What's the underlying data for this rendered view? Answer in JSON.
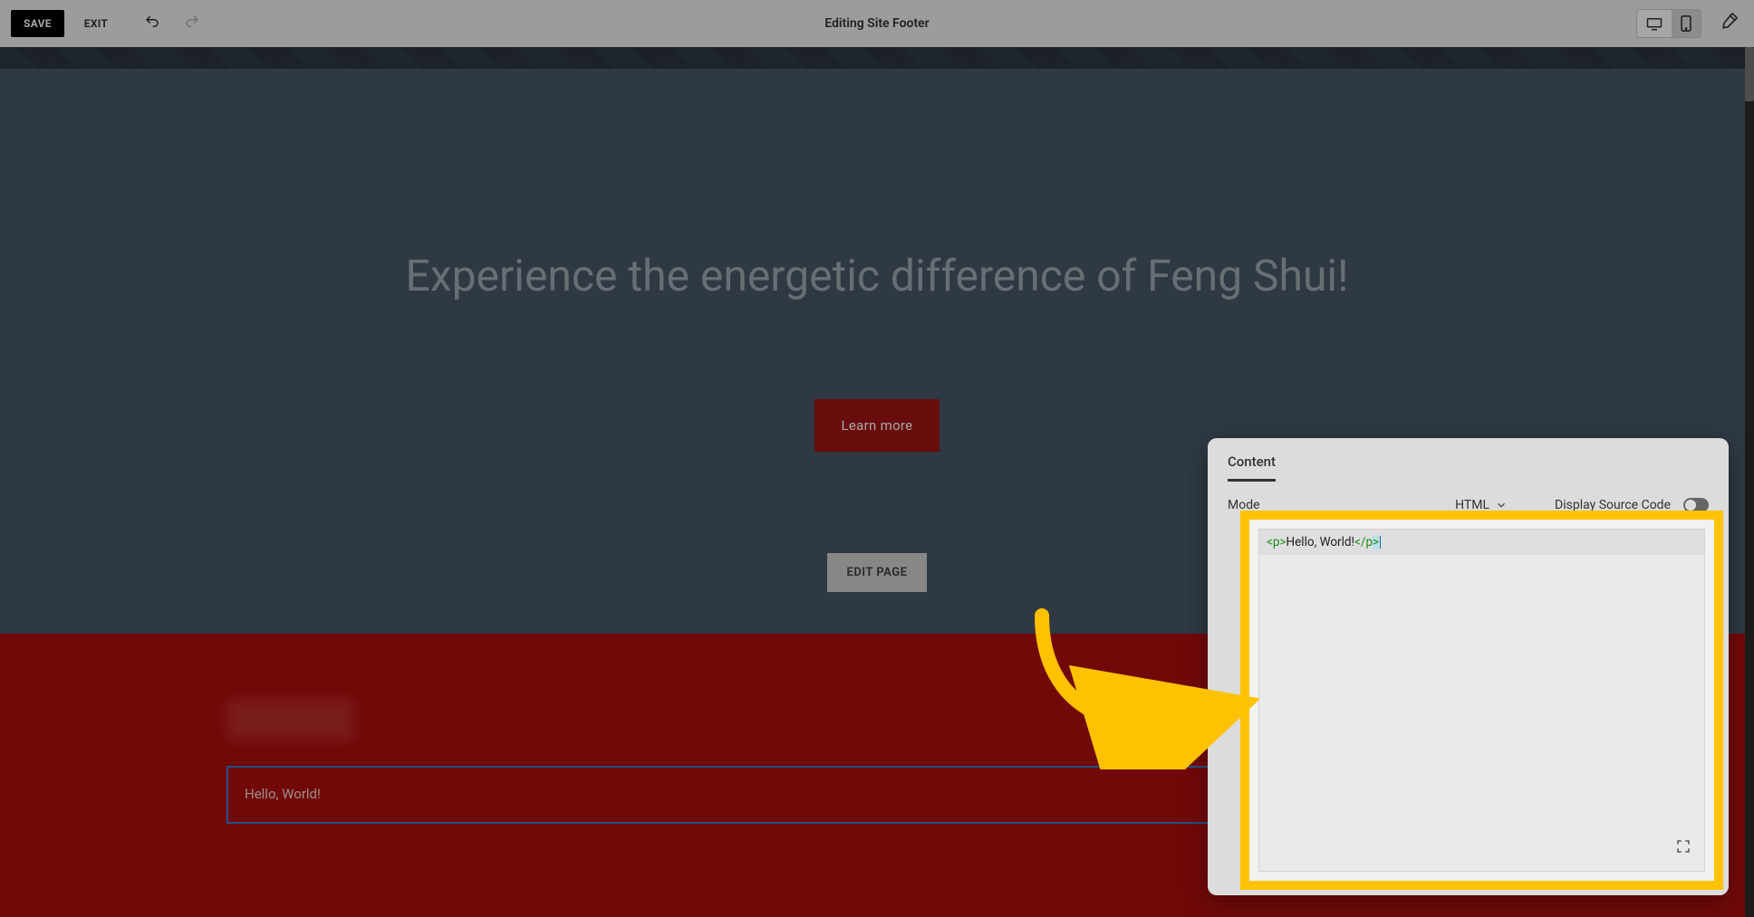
{
  "topbar": {
    "save_label": "SAVE",
    "exit_label": "EXIT",
    "title": "Editing Site Footer"
  },
  "hero": {
    "headline": "Experience the energetic difference of Feng Shui!",
    "learn_more_label": "Learn more",
    "edit_page_label": "EDIT PAGE"
  },
  "footer_block": {
    "rendered_text": "Hello, World!"
  },
  "content_panel": {
    "tab_label": "Content",
    "mode_label": "Mode",
    "mode_value": "HTML",
    "display_source_label": "Display Source Code",
    "code_raw": "<p>Hello, World!</p>",
    "code_tokens": {
      "open": "<p>",
      "text": "Hello, World!",
      "close_slash": "</",
      "close_name": "p",
      "close_gt": ">"
    }
  }
}
